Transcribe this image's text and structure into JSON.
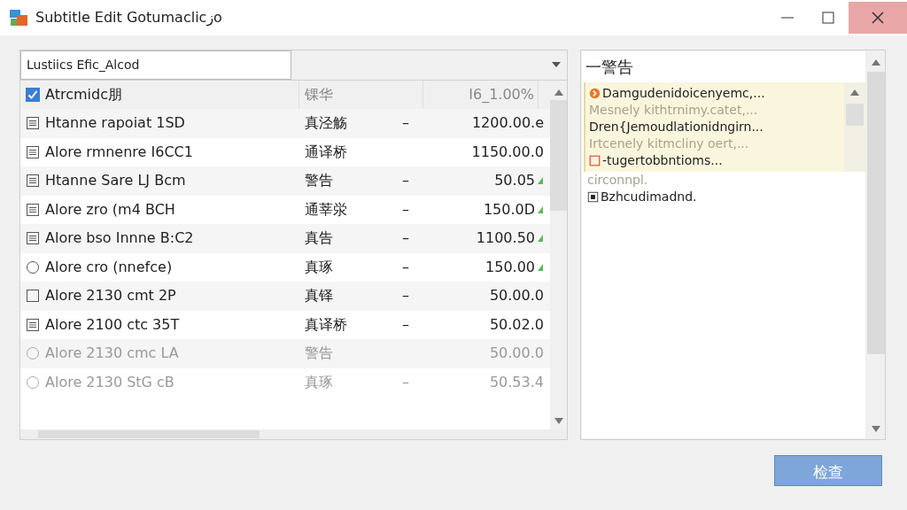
{
  "window": {
    "title": "Subtitle Edit Gotumaclicزo"
  },
  "filter": {
    "value": "Lustiics Efic_Alcod"
  },
  "table": {
    "header": {
      "checked": true,
      "label": "Atrcmidc朋",
      "column_2": "锞华",
      "column_3": "I6_1.00%"
    },
    "rows": [
      {
        "kind": "doc",
        "name": "Htanne rapoiat 1SD",
        "column_2": "真泾觞",
        "column_3": "–",
        "value": "1200.00.e",
        "trend": false,
        "disabled": false
      },
      {
        "kind": "doc",
        "name": "Alore rmnenre I6CC1",
        "column_2": "通译桥",
        "value": "1150.00.0",
        "trend": false,
        "disabled": false
      },
      {
        "kind": "doc",
        "name": "Htanne Sare LJ Bcm",
        "column_2": "警告",
        "column_3": "–",
        "value": "50.05",
        "trend": true,
        "disabled": false
      },
      {
        "kind": "doc",
        "name": "Alore zro (m4 BCH",
        "column_2": "通莘泶",
        "column_3": "–",
        "value": "150.0D",
        "trend": true,
        "disabled": false
      },
      {
        "kind": "doc",
        "name": "Alore bso Innne B:C2",
        "column_2": "真告",
        "column_3": "–",
        "value": "1100.50",
        "trend": true,
        "disabled": false
      },
      {
        "kind": "circle",
        "name": "Alore cro (nnefce)",
        "column_2": "真琢",
        "column_3": "–",
        "value": "150.00",
        "trend": true,
        "disabled": false
      },
      {
        "kind": "square",
        "name": "Alore 2130 cmt 2P",
        "column_2": "真铎",
        "column_3": "–",
        "value": "50.00.0",
        "trend": false,
        "disabled": false
      },
      {
        "kind": "doc",
        "name": "Alore 2100 ctc 35T",
        "column_2": "真译桥",
        "column_3": "–",
        "value": "50.02.0",
        "trend": false,
        "disabled": false
      },
      {
        "kind": "circle",
        "name": "Alore 2130 cmc LA",
        "column_2": "警告",
        "value": "50.00.0",
        "trend": false,
        "disabled": true
      },
      {
        "kind": "circle",
        "name": "Alore 2130 StG cB",
        "column_2": "真琢",
        "column_3": "–",
        "value": "50.53.4",
        "trend": false,
        "disabled": true
      }
    ]
  },
  "panel": {
    "title": "一警告",
    "popup": [
      {
        "kind": "warning",
        "text": "Damgudenidoicenyemc,...",
        "faded": false
      },
      {
        "kind": "text",
        "text": "Mesnely kithtrnimy.catet,...",
        "faded": true
      },
      {
        "kind": "text",
        "text": "Dren{Jemoudlationidngirn...",
        "faded": false
      },
      {
        "kind": "text",
        "text": "Irtcenely kitmcliny oert,...",
        "faded": true
      },
      {
        "kind": "error",
        "text": "-tugertobbntioms...",
        "faded": false
      }
    ],
    "items": [
      {
        "kind": "text",
        "text": "circonnpl.",
        "faded": true
      },
      {
        "kind": "box",
        "text": "Bzhcudimadnd.",
        "faded": false
      }
    ]
  },
  "buttons": [
    {
      "label": "检查"
    }
  ]
}
